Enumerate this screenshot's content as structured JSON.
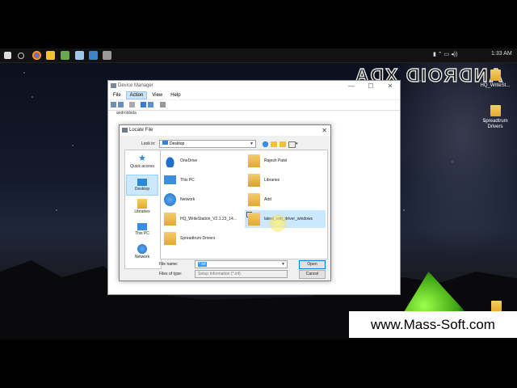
{
  "watermark": "ANDROID XDA",
  "website": "www.Mass-Soft.com",
  "taskbar": {
    "time": "1:33 AM"
  },
  "desktop_icons": [
    {
      "label": "HQ_WriteSt..."
    },
    {
      "label": "Spreadtrum Drivers"
    }
  ],
  "device_manager": {
    "title": "Device Manager",
    "menu": [
      "File",
      "Action",
      "View",
      "Help"
    ],
    "active_menu": "Action",
    "tree_root": "androidxda"
  },
  "dialog": {
    "title": "Locate File",
    "look_in_label": "Look in:",
    "look_in_value": "Desktop",
    "places": [
      {
        "label": "Quick access",
        "icon": "star-icon"
      },
      {
        "label": "Desktop",
        "icon": "desktop-icon"
      },
      {
        "label": "Libraries",
        "icon": "libraries-icon"
      },
      {
        "label": "This PC",
        "icon": "computer-icon"
      },
      {
        "label": "Network",
        "icon": "network-icon"
      }
    ],
    "selected_place": "Desktop",
    "files": [
      {
        "label": "OneDrive",
        "icon": "cloud-icon"
      },
      {
        "label": "Rajesh Patel",
        "icon": "user-folder-icon"
      },
      {
        "label": "This PC",
        "icon": "computer-icon"
      },
      {
        "label": "Libraries",
        "icon": "libraries-icon"
      },
      {
        "label": "Network",
        "icon": "network-icon"
      },
      {
        "label": "Add",
        "icon": "folder-icon"
      },
      {
        "label": "HQ_WriteStation_V2.1.23_14...",
        "icon": "folder-icon"
      },
      {
        "label": "latest_usb_driver_windows",
        "icon": "folder-icon"
      },
      {
        "label": "Spreadtrum Drivers",
        "icon": "folder-icon"
      }
    ],
    "selected_file": "latest_usb_driver_windows",
    "file_name_label": "File name:",
    "file_name_value": "*.inf",
    "file_type_label": "Files of type:",
    "file_type_value": "Setup Information (*.inf)",
    "open_label": "Open",
    "cancel_label": "Cancel"
  }
}
